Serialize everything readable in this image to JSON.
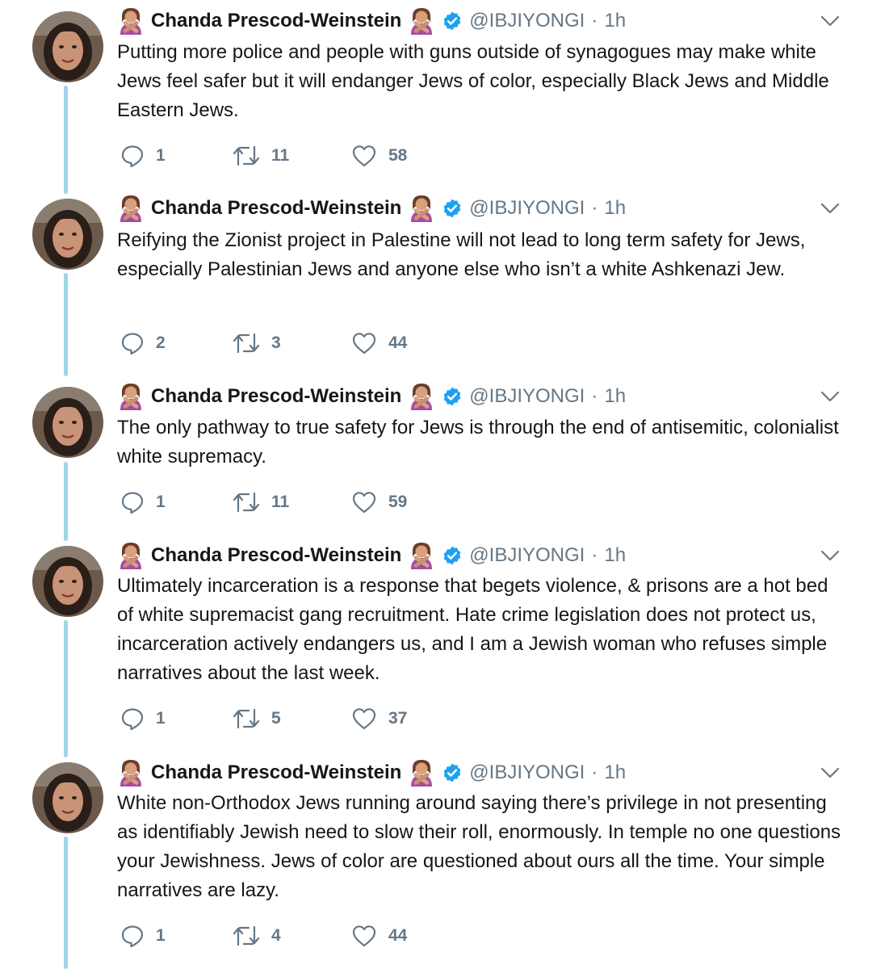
{
  "theme": {
    "thread_line_color": "#9fd6e8",
    "verified_color": "#1da1f2",
    "secondary_text_color": "#657786"
  },
  "tweets": [
    {
      "author_name": "Chanda Prescod-Weinstein",
      "handle": "@IBJIYONGI",
      "separator": "·",
      "time": "1h",
      "text": "Putting more police and people with guns outside of synagogues may make white Jews feel safer but it will endanger Jews of color, especially Black Jews and Middle Eastern Jews.",
      "replies": "1",
      "retweets": "11",
      "likes": "58"
    },
    {
      "author_name": "Chanda Prescod-Weinstein",
      "handle": "@IBJIYONGI",
      "separator": "·",
      "time": "1h",
      "text": "Reifying the Zionist project in Palestine will not lead to long term safety for Jews, especially Palestinian Jews and anyone else who isn’t a white Ashkenazi Jew.",
      "replies": "2",
      "retweets": "3",
      "likes": "44"
    },
    {
      "author_name": "Chanda Prescod-Weinstein",
      "handle": "@IBJIYONGI",
      "separator": "·",
      "time": "1h",
      "text": "The only pathway to true safety for Jews is through the end of antisemitic, colonialist white supremacy.",
      "replies": "1",
      "retweets": "11",
      "likes": "59"
    },
    {
      "author_name": "Chanda Prescod-Weinstein",
      "handle": "@IBJIYONGI",
      "separator": "·",
      "time": "1h",
      "text": "Ultimately incarceration is a response that begets violence, & prisons are a hot bed of white supremacist gang recruitment. Hate crime legislation does not protect us, incarceration actively endangers us, and I am a Jewish woman who refuses simple narratives about the last week.",
      "replies": "1",
      "retweets": "5",
      "likes": "37"
    },
    {
      "author_name": "Chanda Prescod-Weinstein",
      "handle": "@IBJIYONGI",
      "separator": "·",
      "time": "1h",
      "text": "White non-Orthodox Jews running around saying there’s privilege in not presenting as identifiably Jewish need to slow their roll, enormously. In temple no one questions your Jewishness. Jews of color are questioned about ours all the time. Your simple narratives are lazy.",
      "replies": "1",
      "retweets": "4",
      "likes": "44"
    }
  ]
}
